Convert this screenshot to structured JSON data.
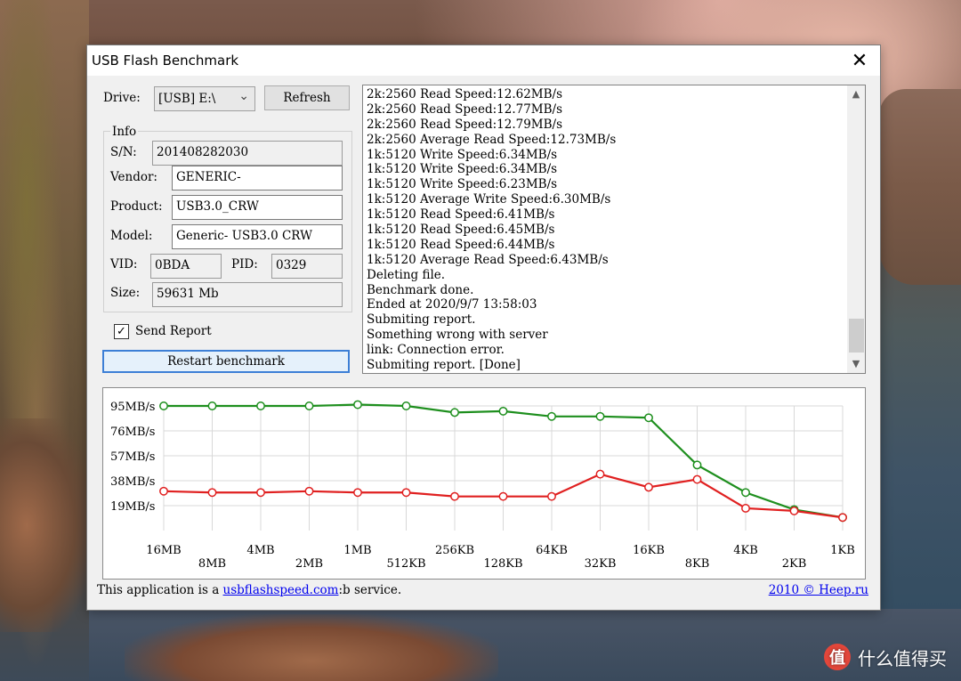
{
  "window": {
    "title": "USB Flash Benchmark",
    "close_glyph": "✕"
  },
  "drive": {
    "label": "Drive:",
    "value": "[USB] E:\\",
    "chevron": "⌄"
  },
  "buttons": {
    "refresh": "Refresh",
    "restart": "Restart benchmark"
  },
  "info": {
    "title": "Info",
    "sn_label": "S/N:",
    "sn_value": "201408282030",
    "vendor_label": "Vendor:",
    "vendor_value": "GENERIC-",
    "product_label": "Product:",
    "product_value": "USB3.0_CRW",
    "model_label": "Model:",
    "model_value": "Generic- USB3.0 CRW",
    "vid_label": "VID:",
    "vid_value": "0BDA",
    "pid_label": "PID:",
    "pid_value": "0329",
    "size_label": "Size:",
    "size_value": "59631 Mb"
  },
  "send_report": {
    "label": "Send Report",
    "checked": true,
    "check_glyph": "✓"
  },
  "log": {
    "lines": [
      "2k:2560 Read Speed:12.62MB/s",
      "2k:2560 Read Speed:12.77MB/s",
      "2k:2560 Read Speed:12.79MB/s",
      "2k:2560 Average Read Speed:12.73MB/s",
      "1k:5120 Write Speed:6.34MB/s",
      "1k:5120 Write Speed:6.34MB/s",
      "1k:5120 Write Speed:6.23MB/s",
      "1k:5120 Average Write Speed:6.30MB/s",
      "1k:5120 Read Speed:6.41MB/s",
      "1k:5120 Read Speed:6.45MB/s",
      "1k:5120 Read Speed:6.44MB/s",
      "1k:5120 Average Read Speed:6.43MB/s",
      "Deleting file.",
      "Benchmark done.",
      "Ended at 2020/9/7 13:58:03",
      "Submiting report.",
      "Something wrong with server",
      "link: Connection error.",
      "Submiting report. [Done]"
    ],
    "scroll_up_glyph": "▲",
    "scroll_down_glyph": "▼"
  },
  "footer": {
    "text_before": "This application is a ",
    "link": "usbflashspeed.com",
    "text_after": ":b service.",
    "copyright_link": "2010 © Heep.ru"
  },
  "chart_data": {
    "type": "line",
    "y_tick_labels": [
      "95MB/s",
      "76MB/s",
      "57MB/s",
      "38MB/s",
      "19MB/s"
    ],
    "y_ticks": [
      95,
      76,
      57,
      38,
      19
    ],
    "ylim": [
      0,
      95
    ],
    "categories": [
      "16MB",
      "8MB",
      "4MB",
      "2MB",
      "1MB",
      "512KB",
      "256KB",
      "128KB",
      "64KB",
      "32KB",
      "16KB",
      "8KB",
      "4KB",
      "2KB",
      "1KB"
    ],
    "grid": true,
    "series": [
      {
        "color": "#1e8f1e",
        "values": [
          95,
          95,
          95,
          95,
          96,
          95,
          90,
          91,
          87,
          87,
          86,
          50,
          29,
          16,
          10
        ]
      },
      {
        "color": "#e02020",
        "values": [
          30,
          29,
          29,
          30,
          29,
          29,
          26,
          26,
          26,
          43,
          33,
          39,
          17,
          15,
          10
        ]
      }
    ]
  },
  "watermark": {
    "logo": "值",
    "text": "什么值得买"
  }
}
